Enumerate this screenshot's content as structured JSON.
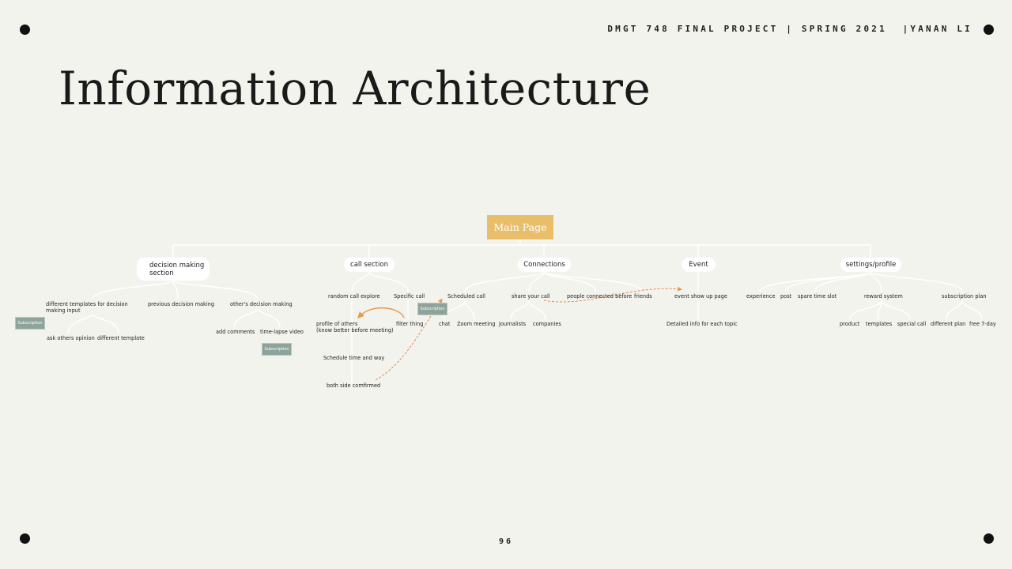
{
  "header": {
    "project_line": "DMGT 748 FINAL PROJECT | SPRING 2021  |YANAN LI",
    "title": "Information Architecture",
    "page_number": "96"
  },
  "diagram": {
    "root": "Main Page",
    "sections": {
      "decision_making": "decision making section",
      "call": "call section",
      "connections": "Connections",
      "event": "Event",
      "settings": "settings/profile"
    },
    "decision_making": {
      "different_templates": "different templates for decision making input",
      "previous": "previous decision making",
      "others": "other's decision making",
      "ask_others": "ask others opinion",
      "different_template": "different template",
      "add_comments": "add comments",
      "time_lapse": "time-lapse video"
    },
    "call": {
      "random_explore": "random call explore",
      "specific_call": "Specific call",
      "profile_line1": "profile of others",
      "profile_line2": "(know better before meeting)",
      "filter_thing": "filter thing",
      "schedule": "Schedule time and way",
      "both_confirmed": "both side comfirmed"
    },
    "connections": {
      "scheduled_call": "Scheduled call",
      "share_call": "share your call",
      "people_connected": "people connected before",
      "friends": "friends",
      "chat": "chat",
      "zoom": "Zoom meeting",
      "journalists": "Journalists",
      "companies": "companies"
    },
    "event": {
      "show_up": "event show up page",
      "detailed_info": "Detailed info for each topic"
    },
    "settings": {
      "experience": "experience",
      "post": "post",
      "spare_time": "spare time slot",
      "reward": "reward system",
      "subscription_plan": "subscription plan",
      "product": "product",
      "templates": "templates",
      "special_call": "special call",
      "different_plan": "different plan",
      "free_trial": "free 7-day"
    },
    "subscription_tag": "Subscription"
  },
  "colors": {
    "background": "#f3f3ee",
    "main_node": "#e9be6b",
    "subscription_tag": "#8ea39c",
    "connector": "#ffffff",
    "arrow_orange": "#e59a4e",
    "arrow_dashed": "#e8884a"
  }
}
